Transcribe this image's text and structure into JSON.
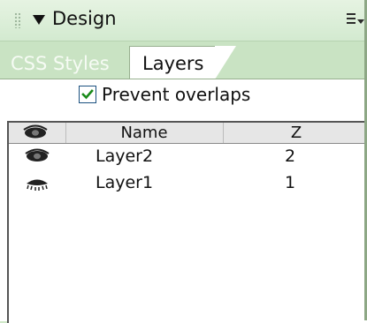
{
  "panel": {
    "title": "Design",
    "tabs": [
      {
        "label": "CSS Styles",
        "active": false
      },
      {
        "label": "Layers",
        "active": true
      }
    ],
    "options_icon": "panel-options-icon",
    "collapse_icon": "triangle-down-icon"
  },
  "layers": {
    "prevent_overlaps": {
      "label": "Prevent overlaps",
      "checked": true
    },
    "columns": {
      "visibility_icon": "eye-icon",
      "name": "Name",
      "z": "Z"
    },
    "rows": [
      {
        "visibility_icon": "eye-open-icon",
        "name": "Layer2",
        "z": "2"
      },
      {
        "visibility_icon": "eye-closed-icon",
        "name": "Layer1",
        "z": "1"
      }
    ]
  },
  "colors": {
    "panel_bg": "#c9e3c3",
    "header_bg": "#e6e6e6",
    "content_bg": "#ffffff",
    "check_color": "#1a8a1a"
  }
}
